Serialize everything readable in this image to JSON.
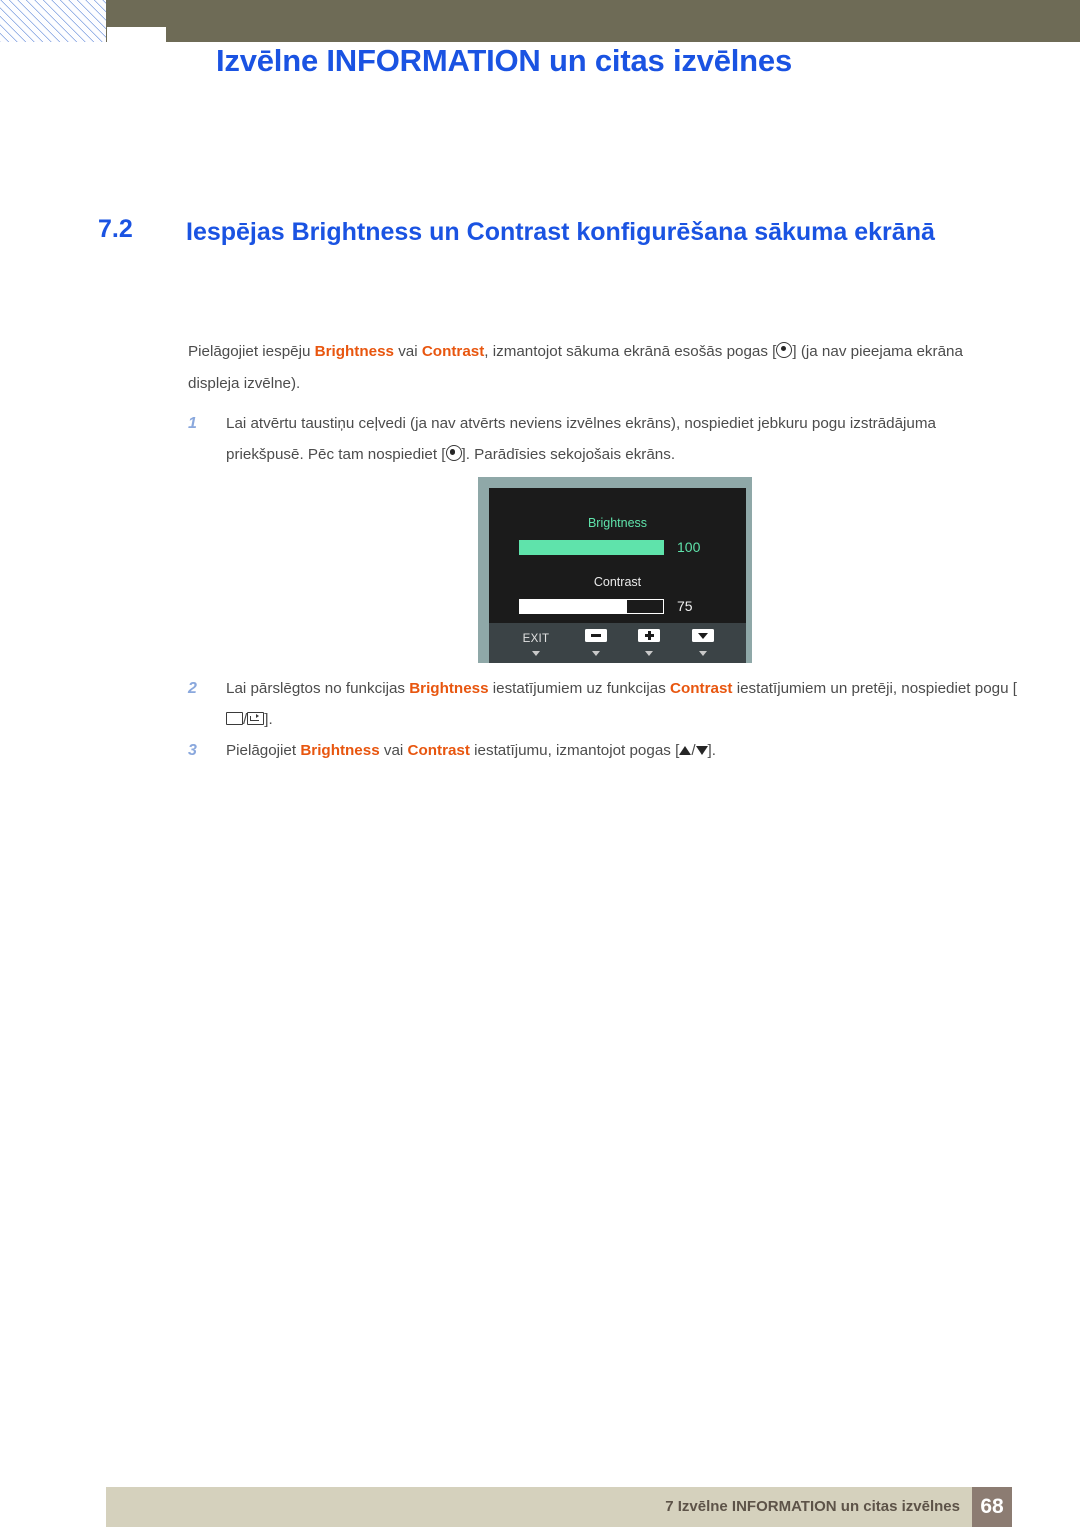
{
  "header": {
    "title": "Izvēlne INFORMATION un citas izvēlnes",
    "title_color": "#1a53e2",
    "bar_color": "#6e6b56"
  },
  "section": {
    "number": "7.2",
    "title": "Iespējas Brightness un Contrast konfigurēšana sākuma ekrānā",
    "color": "#1a53e2"
  },
  "intro": {
    "part1": "Pielāgojiet iespēju ",
    "kw1": "Brightness",
    "part2": " vai ",
    "kw2": "Contrast",
    "part3": ", izmantojot sākuma ekrānā esošās pogas [",
    "part4": "] (ja nav pieejama ekrāna displeja izvēlne)."
  },
  "steps": [
    {
      "number": "1",
      "part1": "Lai atvērtu taustiņu ceļvedi (ja nav atvērts neviens izvēlnes ekrāns), nospiediet jebkuru pogu izstrādājuma priekšpusē. Pēc tam nospiediet [",
      "part2": "]. Parādīsies sekojošais ekrāns."
    },
    {
      "number": "2",
      "part1": "Lai pārslēgtos no funkcijas ",
      "kw1": "Brightness",
      "part2": " iestatījumiem uz funkcijas ",
      "kw2": "Contrast",
      "part3": " iestatījumiem un pretēji, nospiediet pogu [",
      "separator": "/",
      "part4": "]."
    },
    {
      "number": "3",
      "part1": "Pielāgojiet ",
      "kw1": "Brightness",
      "part2": " vai ",
      "kw2": "Contrast",
      "part3": " iestatījumu, izmantojot pogas [",
      "separator": "/",
      "part4": "]."
    }
  ],
  "osd": {
    "brightness_label": "Brightness",
    "brightness_value": "100",
    "brightness_percent": 100,
    "brightness_color": "#5fe3ab",
    "contrast_label": "Contrast",
    "contrast_value": "75",
    "contrast_percent": 75,
    "contrast_color": "#ffffff",
    "screen_bg": "#1b1b1b",
    "frame_color": "#8fa8a8",
    "buttonbar_color": "#3b4346",
    "buttons": [
      {
        "label": "EXIT",
        "icon": "none"
      },
      {
        "label": "",
        "icon": "minus-icon"
      },
      {
        "label": "",
        "icon": "plus-icon"
      },
      {
        "label": "",
        "icon": "triangle-down-icon"
      }
    ]
  },
  "footer": {
    "text": "7 Izvēlne INFORMATION un citas izvēlnes",
    "page": "68",
    "bar_color": "#d5d1bd",
    "page_box_color": "#8c7c72"
  }
}
